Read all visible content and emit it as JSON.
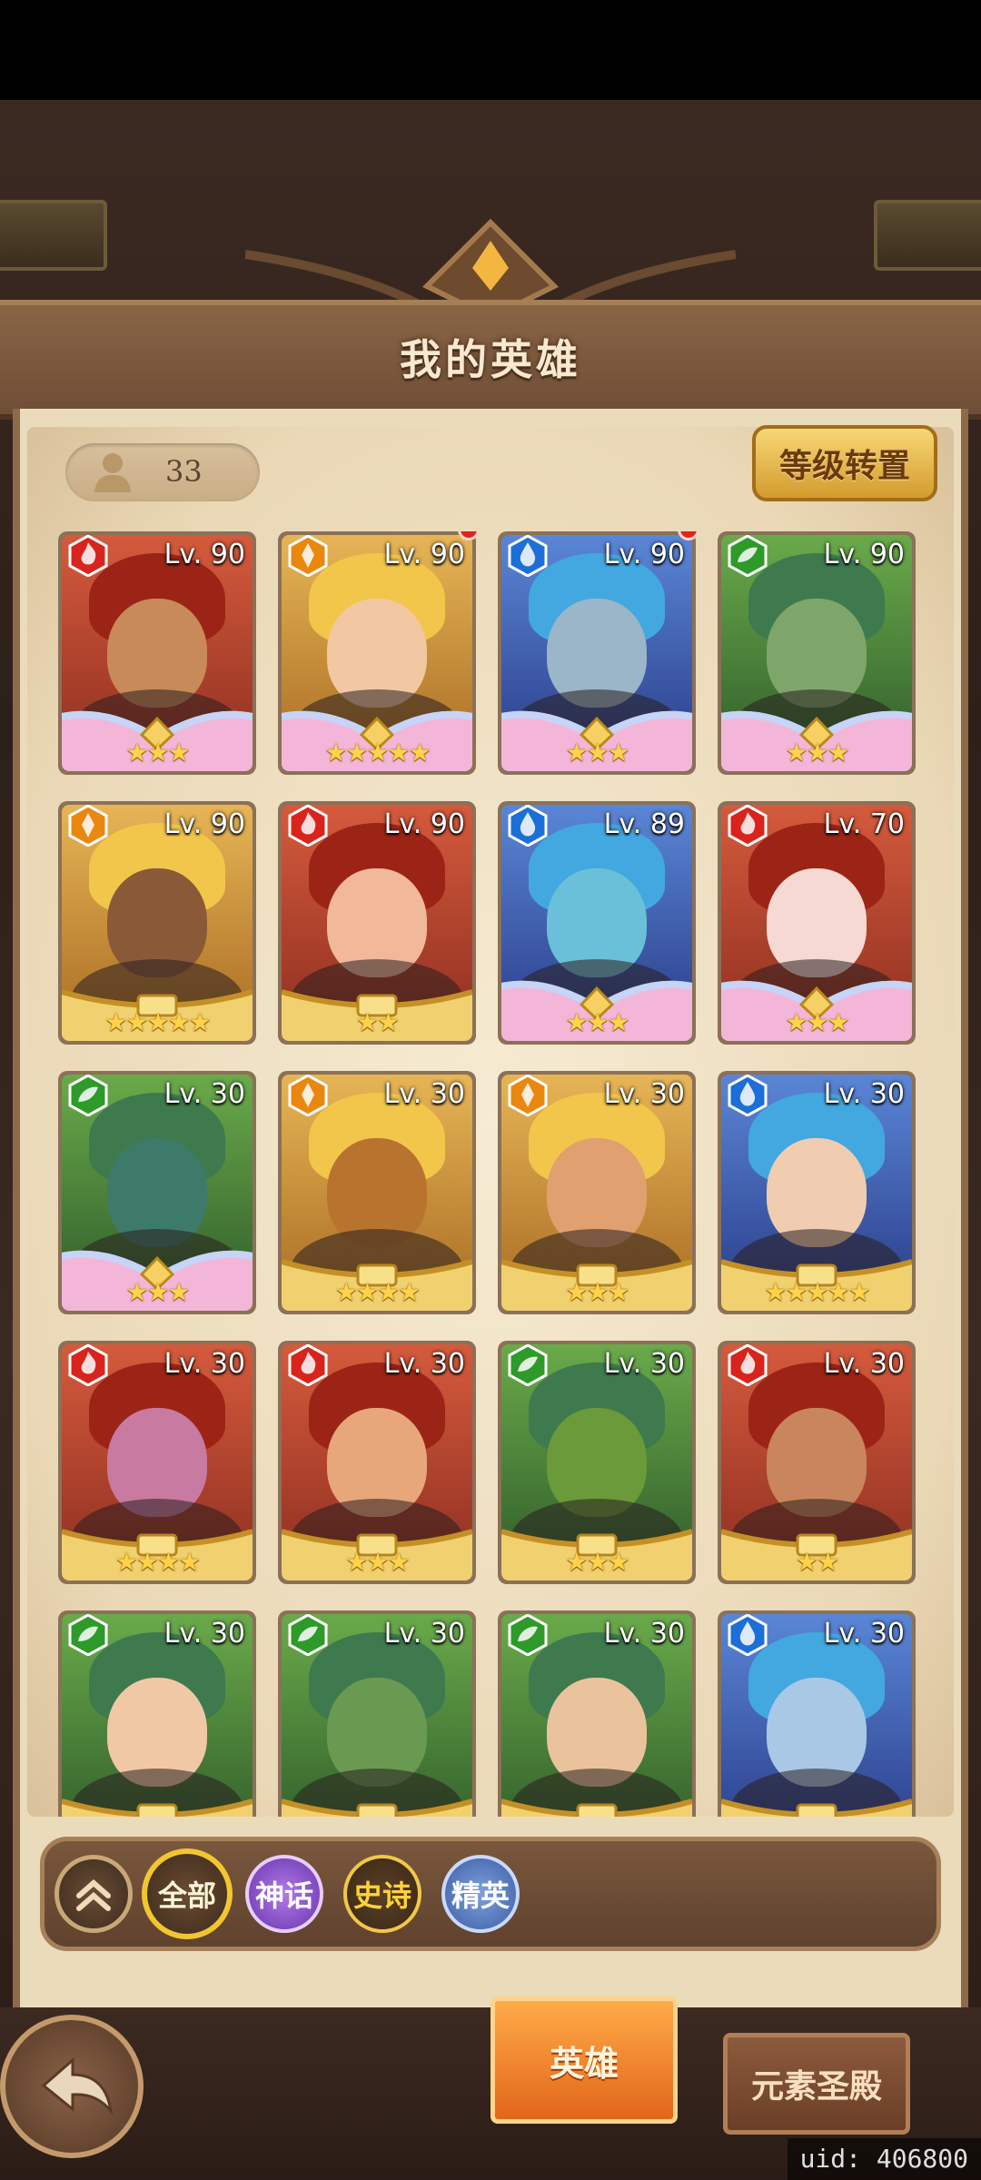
{
  "header": {
    "title": "我的英雄"
  },
  "toolbar": {
    "hero_count": "33",
    "level_reset_label": "等级转置"
  },
  "colors": {
    "fire": "#d8241c",
    "light": "#e9870f",
    "water": "#1c6fd6",
    "nature": "#2d9a2a",
    "star": "#ffd24a",
    "accent": "#f3c530"
  },
  "heroes": [
    {
      "level": "Lv. 90",
      "element": "fire",
      "stars": "★★★",
      "rarity": "mythic",
      "red_dot": false
    },
    {
      "level": "Lv. 90",
      "element": "light",
      "stars": "★★★★★",
      "rarity": "mythic",
      "red_dot": true
    },
    {
      "level": "Lv. 90",
      "element": "water",
      "stars": "★★★",
      "rarity": "mythic",
      "red_dot": true
    },
    {
      "level": "Lv. 90",
      "element": "nature",
      "stars": "★★★",
      "rarity": "mythic",
      "red_dot": false
    },
    {
      "level": "Lv. 90",
      "element": "light",
      "stars": "★★★★★",
      "rarity": "epic",
      "red_dot": false
    },
    {
      "level": "Lv. 90",
      "element": "fire",
      "stars": "★★",
      "rarity": "epic",
      "red_dot": false
    },
    {
      "level": "Lv. 89",
      "element": "water",
      "stars": "★★★",
      "rarity": "mythic",
      "red_dot": false
    },
    {
      "level": "Lv. 70",
      "element": "fire",
      "stars": "★★★",
      "rarity": "mythic",
      "red_dot": false
    },
    {
      "level": "Lv. 30",
      "element": "nature",
      "stars": "★★★",
      "rarity": "mythic",
      "red_dot": false
    },
    {
      "level": "Lv. 30",
      "element": "light",
      "stars": "★★★★",
      "rarity": "epic",
      "red_dot": false
    },
    {
      "level": "Lv. 30",
      "element": "light",
      "stars": "★★★",
      "rarity": "epic",
      "red_dot": false
    },
    {
      "level": "Lv. 30",
      "element": "water",
      "stars": "★★★★★",
      "rarity": "epic",
      "red_dot": false
    },
    {
      "level": "Lv. 30",
      "element": "fire",
      "stars": "★★★★",
      "rarity": "epic",
      "red_dot": false
    },
    {
      "level": "Lv. 30",
      "element": "fire",
      "stars": "★★★",
      "rarity": "epic",
      "red_dot": false
    },
    {
      "level": "Lv. 30",
      "element": "nature",
      "stars": "★★★",
      "rarity": "epic",
      "red_dot": false
    },
    {
      "level": "Lv. 30",
      "element": "fire",
      "stars": "★★",
      "rarity": "epic",
      "red_dot": false
    },
    {
      "level": "Lv. 30",
      "element": "nature",
      "stars": "",
      "rarity": "epic",
      "red_dot": false
    },
    {
      "level": "Lv. 30",
      "element": "nature",
      "stars": "",
      "rarity": "epic",
      "red_dot": false
    },
    {
      "level": "Lv. 30",
      "element": "nature",
      "stars": "",
      "rarity": "epic",
      "red_dot": false
    },
    {
      "level": "Lv. 30",
      "element": "water",
      "stars": "",
      "rarity": "epic",
      "red_dot": false
    }
  ],
  "filters": {
    "all": "全部",
    "mythic": "神话",
    "epic": "史诗",
    "elite": "精英"
  },
  "tabs": {
    "heroes": "英雄",
    "element_temple": "元素圣殿"
  },
  "footer": {
    "uid": "uid: 406800"
  }
}
